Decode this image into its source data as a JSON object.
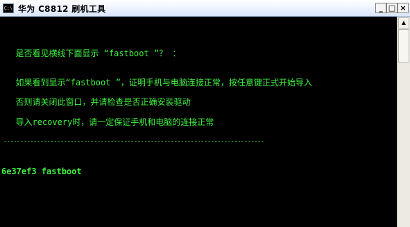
{
  "window": {
    "title": "华为 C8812 刷机工具",
    "app_icon_label": "C:\\",
    "icon": "console-icon",
    "buttons": {
      "minimize": "_",
      "maximize": "□",
      "close": "×"
    }
  },
  "console": {
    "lines": [
      "  是否看见横线下面显示 “fastboot ”？ ：",
      "  如果看到显示“fastboot ”，证明手机与电脑连接正常，按任意键正式开始导入",
      "  否则请关闭此窗口，并请检查是否正确安装驱动",
      "  导入recovery时，请一定保证手机和电脑的连接正常",
      " ------------------------------------------------------------------------------",
      "6e37ef3 fastboot"
    ]
  },
  "scrollbar": {
    "up_arrow": "▲"
  },
  "colors": {
    "console_text": "#3ff23f",
    "console_bg": "#000000"
  }
}
